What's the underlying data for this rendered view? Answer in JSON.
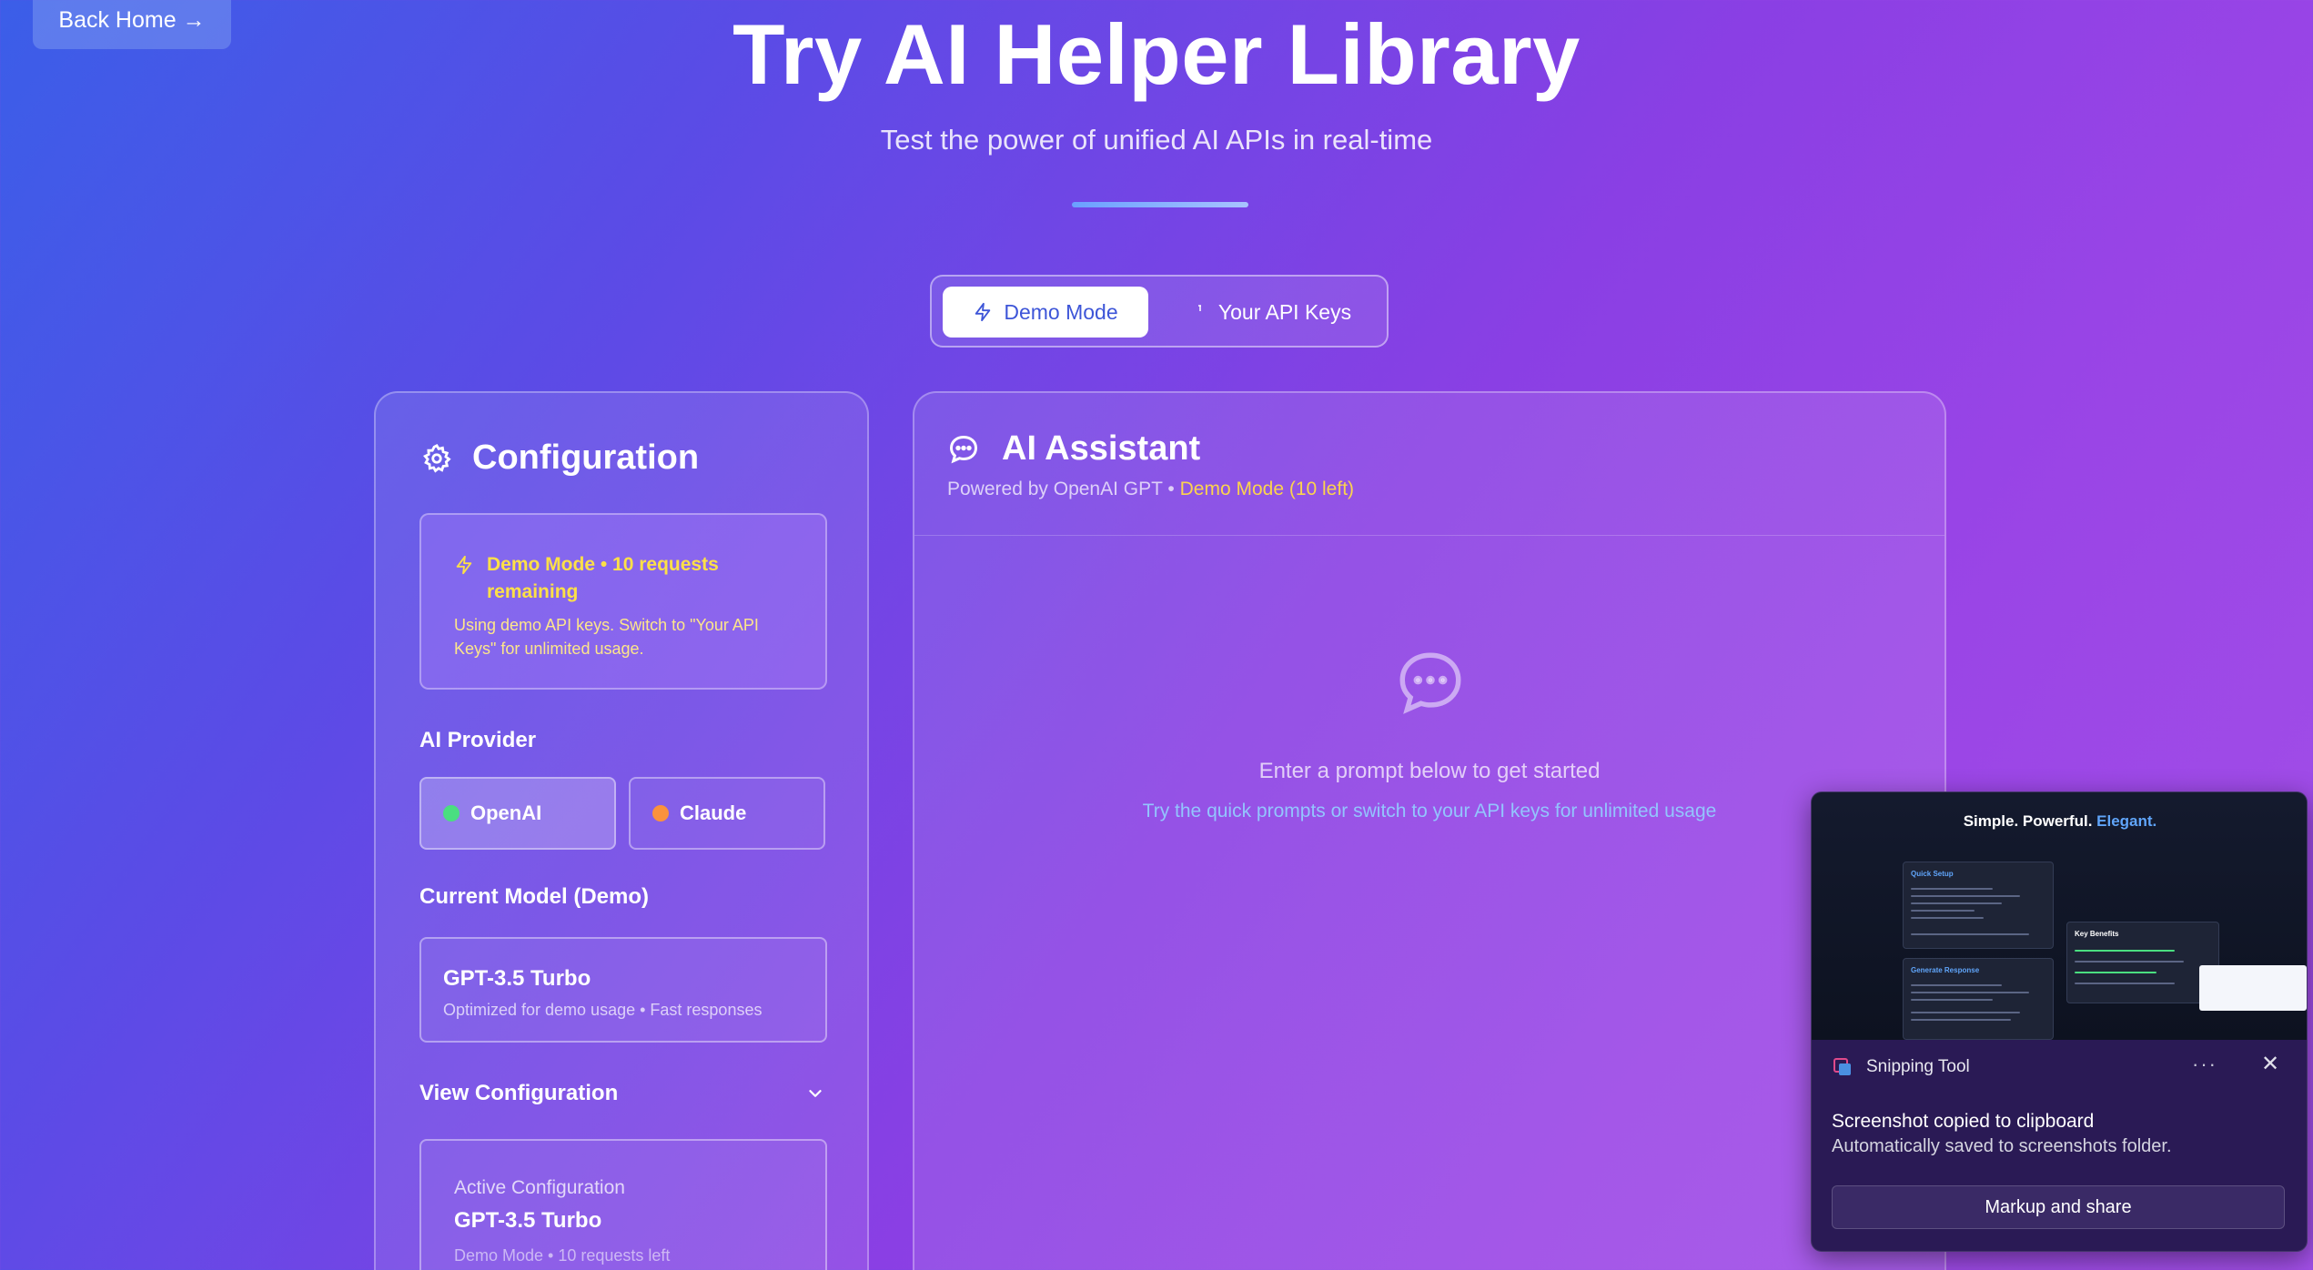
{
  "header": {
    "back_label": "Back Home →",
    "title": "Try AI Helper Library",
    "subtitle": "Test the power of unified AI APIs in real-time"
  },
  "mode_toggle": {
    "demo_label": "Demo Mode",
    "keys_label": "Your API Keys",
    "active": "demo"
  },
  "config": {
    "title": "Configuration",
    "demo_notice_title": "Demo Mode • 10 requests remaining",
    "demo_notice_text": "Using demo API keys. Switch to \"Your API Keys\" for unlimited usage.",
    "provider_label": "AI Provider",
    "providers": [
      {
        "label": "OpenAI",
        "color": "#4ade80",
        "selected": true
      },
      {
        "label": "Claude",
        "color": "#fb923c",
        "selected": false
      }
    ],
    "model_label": "Current Model (Demo)",
    "model_name": "GPT-3.5 Turbo",
    "model_desc": "Optimized for demo usage • Fast responses",
    "view_config_label": "View Configuration",
    "active_config_label": "Active Configuration",
    "active_model": "GPT-3.5 Turbo",
    "active_status": "Demo Mode • 10 requests left"
  },
  "assistant": {
    "title": "AI Assistant",
    "powered_by": "Powered by OpenAI GPT •",
    "mode_status": "Demo Mode (10 left)",
    "empty_main": "Enter a prompt below to get started",
    "empty_sub": "Try the quick prompts or switch to your API keys for unlimited usage"
  },
  "notification": {
    "app_name": "Snipping Tool",
    "title": "Screenshot copied to clipboard",
    "text": "Automatically saved to screenshots folder.",
    "action_label": "Markup and share",
    "preview": {
      "headline": "Simple. Powerful.",
      "headline_accent": "Elegant.",
      "panel_labels": [
        "Quick Setup",
        "Key Benefits",
        "Generate Response"
      ]
    }
  },
  "colors": {
    "accent": "#3d55d8",
    "warning": "#fde047",
    "link": "#93c5fd"
  }
}
